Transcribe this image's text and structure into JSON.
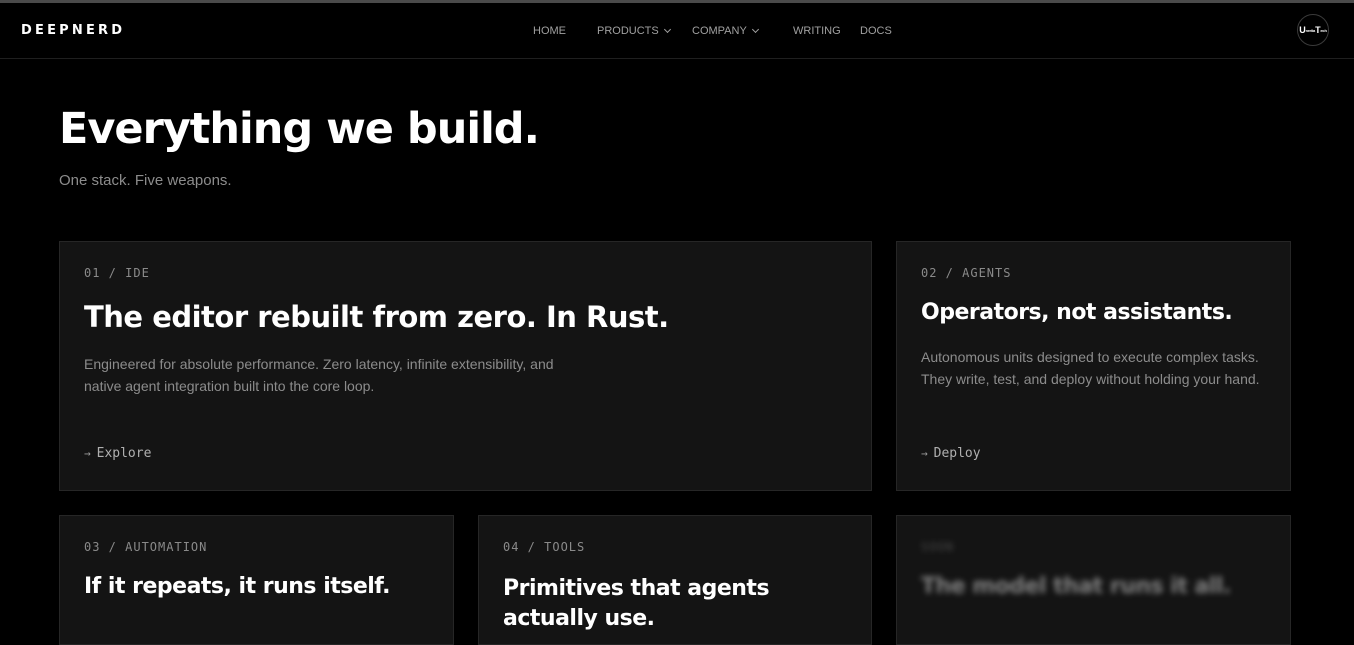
{
  "nav": {
    "logo": "DEEPNERD",
    "links": [
      {
        "label": "HOME",
        "dropdown": false
      },
      {
        "label": "PRODUCTS",
        "dropdown": true
      },
      {
        "label": "COMPANY",
        "dropdown": true
      },
      {
        "label": "WRITING",
        "dropdown": false
      },
      {
        "label": "DOCS",
        "dropdown": false
      }
    ],
    "avatar": {
      "letter1": "U",
      "text1": "nrelia",
      "letter2": "T",
      "text2": "ech"
    }
  },
  "hero": {
    "title": "Everything we build.",
    "subtitle": "One stack. Five weapons."
  },
  "cards": [
    {
      "tag": "01 / IDE",
      "title": "The editor rebuilt from zero. In Rust.",
      "description": "Engineered for absolute performance. Zero latency, infinite extensibility, and native agent integration built into the core loop.",
      "link": "Explore"
    },
    {
      "tag": "02 / AGENTS",
      "title": "Operators, not assistants.",
      "description": "Autonomous units designed to execute complex tasks. They write, test, and deploy without holding your hand.",
      "link": "Deploy"
    },
    {
      "tag": "03 / AUTOMATION",
      "title": "If it repeats, it runs itself."
    },
    {
      "tag": "04 / TOOLS",
      "title": "Primitives that agents actually use."
    },
    {
      "tag": "SOON",
      "title": "The model that runs it all."
    }
  ],
  "colors": {
    "background": "#000000",
    "card": "#141414",
    "card_border": "#262626",
    "muted_text": "#8c8c8c"
  }
}
